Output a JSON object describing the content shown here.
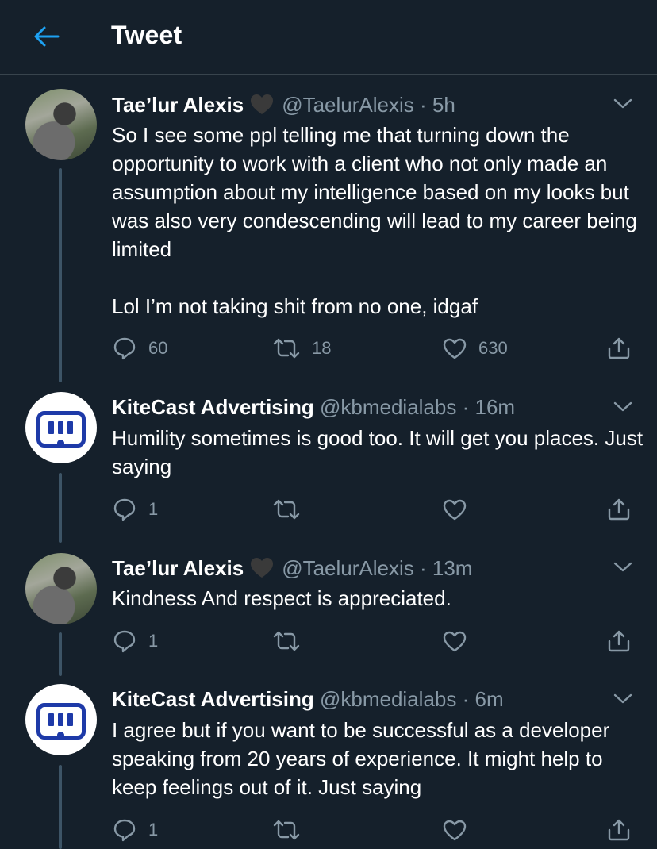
{
  "header": {
    "title": "Tweet"
  },
  "tweets": [
    {
      "name": "Tae’lur Alexis",
      "handle": "@TaelurAlexis",
      "sep": "·",
      "time": "5h",
      "text": "So I see some ppl telling me that turning down the opportunity to work with a client who not only made an assumption about my intelligence based on my looks but was also very condescending will lead to my career being limited\n\nLol I’m not taking shit from no one, idgaf",
      "replies": "60",
      "retweets": "18",
      "likes": "630"
    },
    {
      "name": "KiteCast Advertising",
      "handle": "@kbmedialabs",
      "sep": "·",
      "time": "16m",
      "text": "Humility sometimes is good too. It will get you places. Just saying",
      "replies": "1"
    },
    {
      "name": "Tae’lur Alexis",
      "handle": "@TaelurAlexis",
      "sep": "·",
      "time": "13m",
      "text": "Kindness And respect is appreciated.",
      "replies": "1"
    },
    {
      "name": "KiteCast Advertising",
      "handle": "@kbmedialabs",
      "sep": "·",
      "time": "6m",
      "text": "I agree but if you want to be successful as a developer speaking from 20 years of experience. It might help to keep feelings out of it. Just saying",
      "replies": "1"
    }
  ],
  "colors": {
    "background": "#15202b",
    "accent": "#1da1f2",
    "muted": "#8899a6",
    "thread_line": "#3d5466"
  }
}
